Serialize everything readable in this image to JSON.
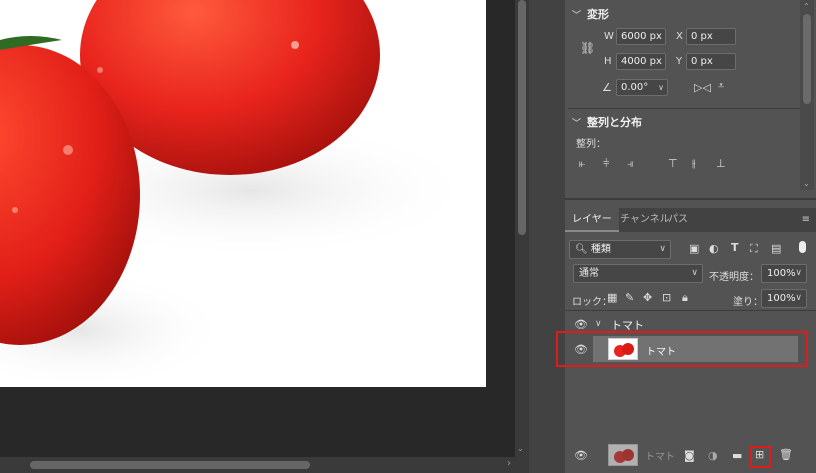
{
  "properties": {
    "transform_title": "変形",
    "w_label": "W",
    "w_value": "6000 px",
    "h_label": "H",
    "h_value": "4000 px",
    "x_label": "X",
    "x_value": "0 px",
    "y_label": "Y",
    "y_value": "0 px",
    "angle_value": "0.00°",
    "align_title": "整列と分布",
    "align_label": "整列："
  },
  "layers_panel": {
    "tabs": [
      "レイヤー",
      "チャンネル",
      "パス"
    ],
    "filter_kind": "種類",
    "blend_mode": "通常",
    "opacity_label": "不透明度：",
    "opacity_value": "100%",
    "lock_label": "ロック：",
    "fill_label": "塗り：",
    "fill_value": "100%",
    "group_name": "トマト",
    "layer_name": "トマト",
    "drag_ghost_name": "トマト"
  },
  "colors": {
    "highlight": "#e01b1b",
    "selected_layer": "#727272",
    "tomato": "#e8241d"
  }
}
